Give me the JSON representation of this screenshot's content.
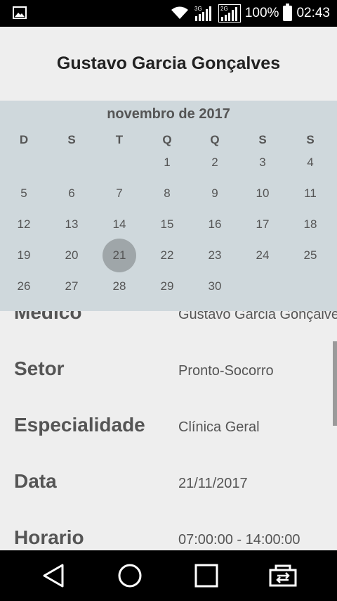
{
  "status_bar": {
    "network_3g": "3G",
    "network_2g": "2G",
    "battery": "100%",
    "time": "02:43",
    "icons": [
      "gallery-icon",
      "wifi-icon",
      "signal-icon",
      "battery-icon"
    ]
  },
  "header": {
    "title": "Gustavo Garcia Gonçalves"
  },
  "calendar": {
    "month_label": "novembro de 2017",
    "weekdays": [
      "D",
      "S",
      "T",
      "Q",
      "Q",
      "S",
      "S"
    ],
    "first_weekday_index": 3,
    "days": [
      "1",
      "2",
      "3",
      "4",
      "5",
      "6",
      "7",
      "8",
      "9",
      "10",
      "11",
      "12",
      "13",
      "14",
      "15",
      "16",
      "17",
      "18",
      "19",
      "20",
      "21",
      "22",
      "23",
      "24",
      "25",
      "26",
      "27",
      "28",
      "29",
      "30"
    ],
    "selected_day": "21",
    "colors": {
      "background": "#cfd8dc",
      "selected": "#9fa6a9"
    }
  },
  "details": [
    {
      "label": "Médico",
      "value": "Gustavo Garcia Gonçalves"
    },
    {
      "label": "Setor",
      "value": "Pronto-Socorro"
    },
    {
      "label": "Especialidade",
      "value": "Clínica Geral"
    },
    {
      "label": "Data",
      "value": "21/11/2017"
    },
    {
      "label": "Horario",
      "value": "07:00:00 - 14:00:00"
    }
  ],
  "nav_bar": {
    "buttons": [
      "back-icon",
      "home-icon",
      "recents-icon",
      "screen-switch-icon"
    ]
  }
}
